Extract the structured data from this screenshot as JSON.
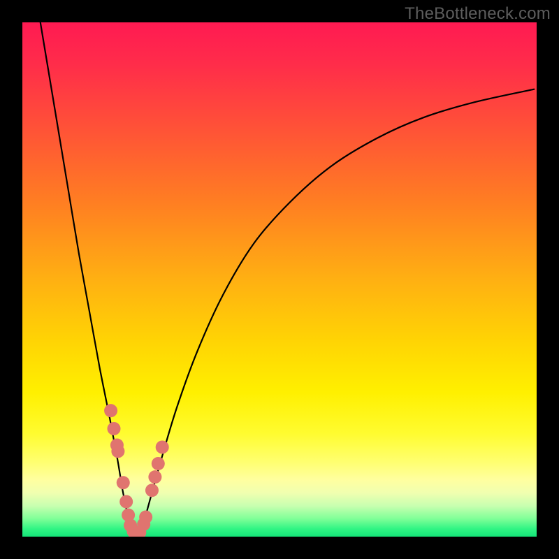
{
  "watermark": {
    "text": "TheBottleneck.com"
  },
  "colors": {
    "frame": "#000000",
    "curve": "#000000",
    "dot": "#e0746f",
    "gradient_stops": [
      {
        "offset": 0.0,
        "color": "#ff1a52"
      },
      {
        "offset": 0.08,
        "color": "#ff2c4a"
      },
      {
        "offset": 0.2,
        "color": "#ff5038"
      },
      {
        "offset": 0.35,
        "color": "#ff7e22"
      },
      {
        "offset": 0.5,
        "color": "#ffb012"
      },
      {
        "offset": 0.62,
        "color": "#ffd404"
      },
      {
        "offset": 0.72,
        "color": "#fff000"
      },
      {
        "offset": 0.8,
        "color": "#fffc30"
      },
      {
        "offset": 0.855,
        "color": "#ffff70"
      },
      {
        "offset": 0.89,
        "color": "#ffffa0"
      },
      {
        "offset": 0.915,
        "color": "#f0ffb0"
      },
      {
        "offset": 0.94,
        "color": "#c8ffb0"
      },
      {
        "offset": 0.965,
        "color": "#80ff98"
      },
      {
        "offset": 0.985,
        "color": "#30f584"
      },
      {
        "offset": 1.0,
        "color": "#14e478"
      }
    ]
  },
  "chart_data": {
    "type": "line",
    "title": "",
    "xlabel": "",
    "ylabel": "",
    "x_range": [
      0,
      100
    ],
    "y_range": [
      0,
      100
    ],
    "series": [
      {
        "name": "left-branch",
        "x": [
          3.5,
          5,
          7,
          9,
          11,
          13,
          15,
          17,
          18.5,
          19.5,
          20.3,
          20.8,
          21.2
        ],
        "y": [
          100,
          91,
          79,
          67,
          55,
          44,
          33,
          23,
          15,
          9,
          5,
          2,
          0.5
        ]
      },
      {
        "name": "right-branch",
        "x": [
          23.0,
          24.5,
          27,
          30,
          34,
          39,
          45,
          52,
          60,
          69,
          78,
          88,
          99.5
        ],
        "y": [
          0.5,
          6,
          15,
          25,
          36,
          47,
          57,
          65,
          72,
          77.5,
          81.5,
          84.5,
          87
        ]
      }
    ],
    "highlight_points": {
      "name": "salmon-dots",
      "x": [
        17.2,
        17.8,
        18.4,
        18.6,
        19.6,
        20.2,
        20.6,
        21.0,
        21.6,
        22.2,
        22.8,
        23.6,
        24.0,
        25.2,
        25.8,
        26.4,
        27.2
      ],
      "y": [
        24.5,
        21.0,
        17.8,
        16.6,
        10.5,
        6.8,
        4.2,
        2.2,
        1.0,
        0.7,
        0.8,
        2.4,
        3.8,
        9.0,
        11.6,
        14.2,
        17.4
      ]
    }
  }
}
